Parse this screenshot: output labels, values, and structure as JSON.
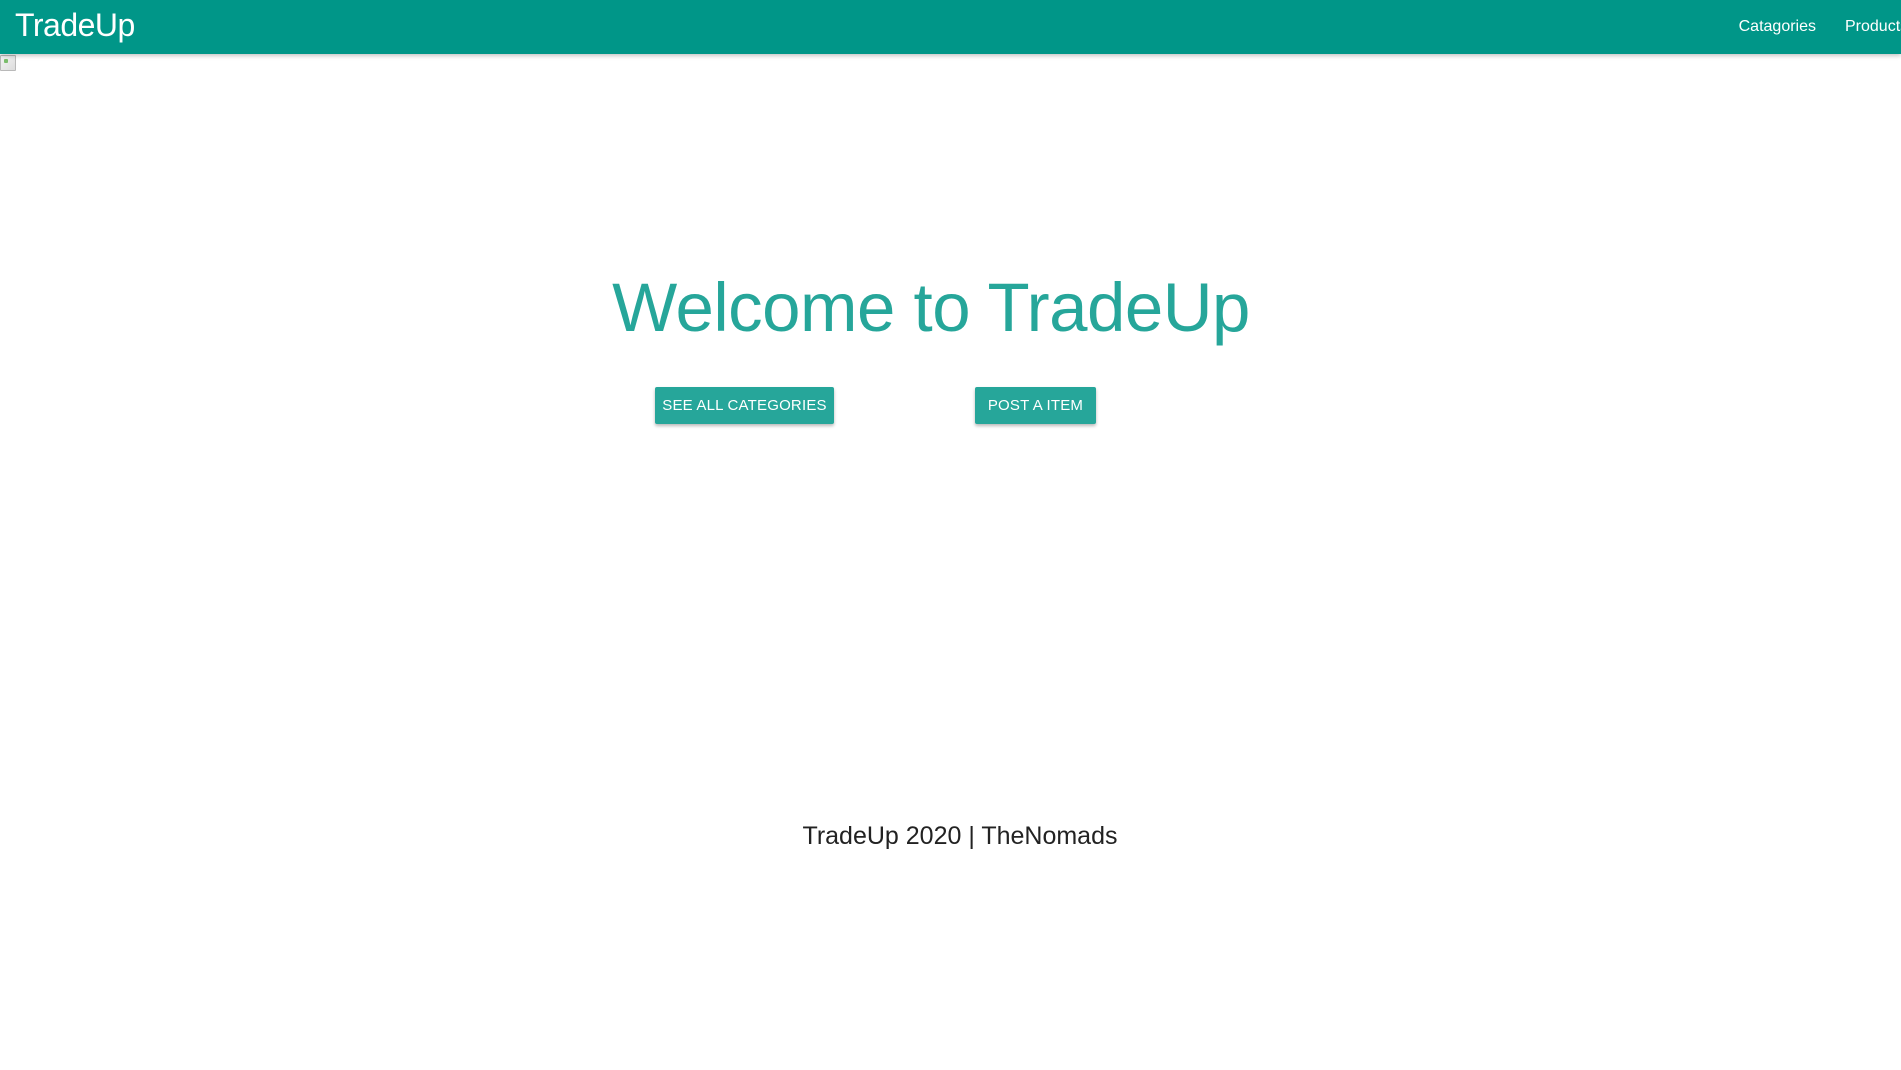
{
  "navbar": {
    "brand": "TradeUp",
    "links": [
      {
        "label": "Catagories"
      },
      {
        "label": "Products"
      }
    ]
  },
  "hero": {
    "title": "Welcome to TradeUp",
    "buttons": {
      "see_all_categories": "SEE ALL CATEGORIES",
      "post_item": "POST A ITEM"
    }
  },
  "footer": {
    "text": "TradeUp 2020 | TheNomads"
  },
  "colors": {
    "navbar_background": "#009688",
    "accent": "#26a69a",
    "footer_text": "#222222"
  },
  "icons": {
    "hero_image": "broken-image-icon"
  }
}
